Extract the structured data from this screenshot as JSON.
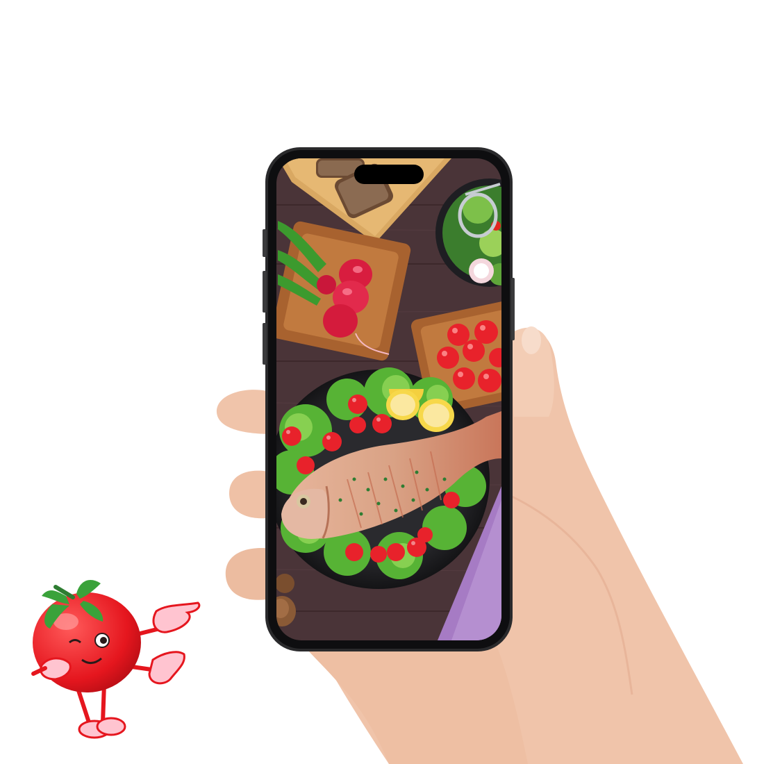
{
  "scene": {
    "background_color": "#ffffff",
    "skin_color": "#f2c9b0",
    "phone_frame_color": "#1c1c1e",
    "wood_color": "#4a3438",
    "tomato_color": "#e8222b",
    "leaf_color": "#3aa23a"
  },
  "icons": {
    "mascot": "tomato-mascot-icon",
    "phone": "smartphone-icon"
  }
}
